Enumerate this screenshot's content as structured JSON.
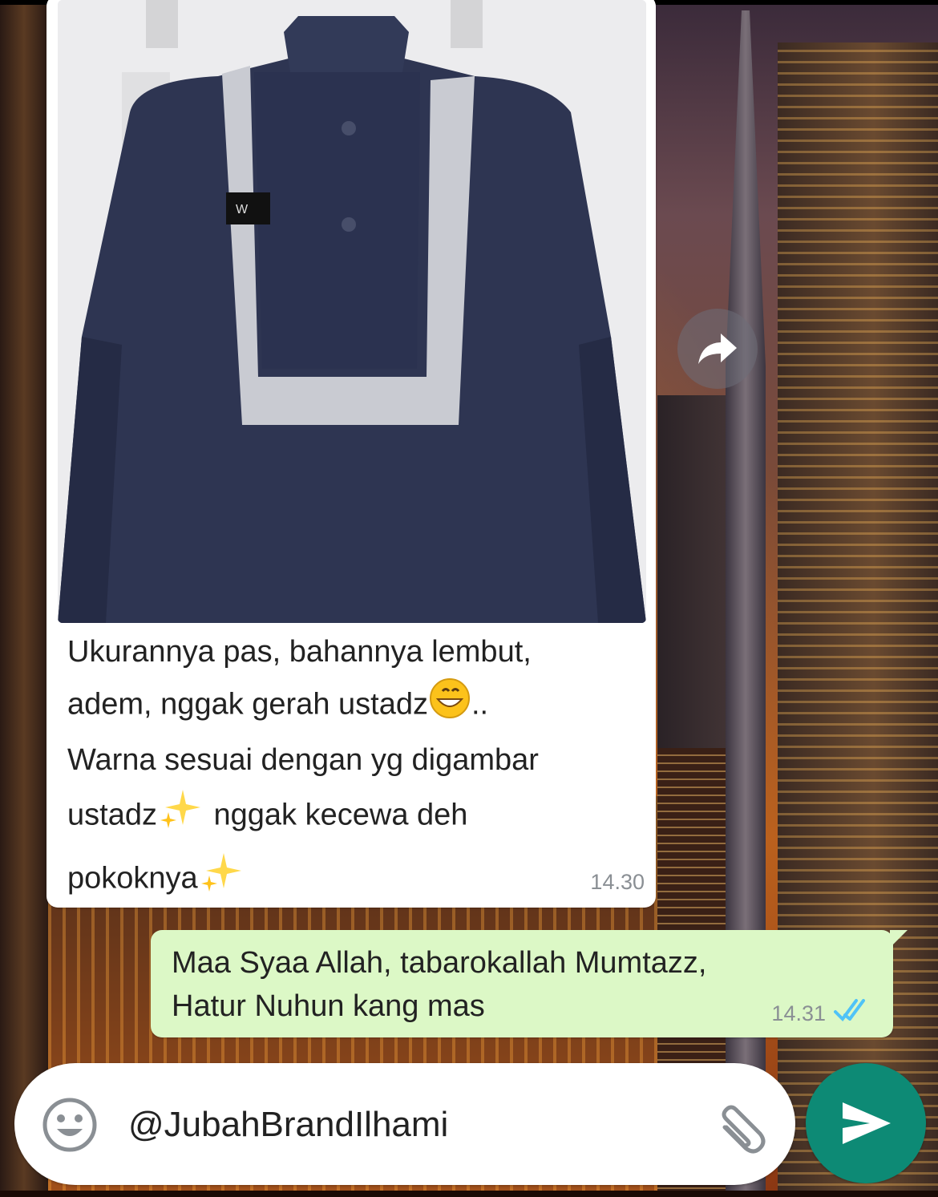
{
  "chat": {
    "incoming": {
      "text_lines": [
        "Ukurannya pas, bahannya lembut,",
        "adem, nggak gerah ustadz",
        "..",
        "Warna sesuai dengan yg digambar",
        "ustadz",
        " nggak kecewa deh",
        "pokoknya"
      ],
      "time": "14.30",
      "image_icon": "photo-image"
    },
    "outgoing": {
      "text_lines": [
        "Maa Syaa Allah, tabarokallah Mumtazz,",
        "Hatur Nuhun kang mas"
      ],
      "time": "14.31",
      "status_icon": "double-check-icon",
      "status_color": "#4fc3f7"
    }
  },
  "input": {
    "value": "@JubahBrandIlhami",
    "emoji_icon": "smiley-icon",
    "attach_icon": "paperclip-icon"
  },
  "actions": {
    "forward_icon": "forward-arrow-icon",
    "send_icon": "send-arrow-icon",
    "send_color": "#0d8a75"
  }
}
